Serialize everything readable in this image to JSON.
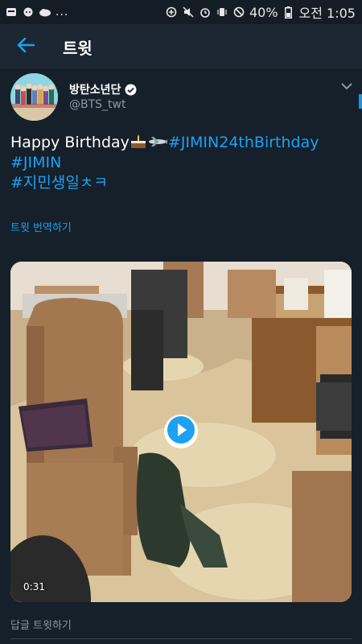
{
  "status_bar": {
    "battery": "40%",
    "time": "오전 1:05",
    "dots": "..."
  },
  "app_bar": {
    "title": "트윗"
  },
  "tweet": {
    "display_name": "방탄소년단",
    "handle": "@BTS_twt",
    "text_plain": "Happy Birthday",
    "hashtags": [
      "#JIMIN24thBirthday",
      "#JIMIN",
      "#지민생일ㅊㅋ"
    ],
    "translate_label": "트윗 번역하기",
    "video_duration": "0:31"
  },
  "reply": {
    "placeholder": "답글 트윗하기"
  },
  "colors": {
    "background": "#15202b",
    "accent": "#1da1f2",
    "secondary_text": "#8899a6"
  }
}
